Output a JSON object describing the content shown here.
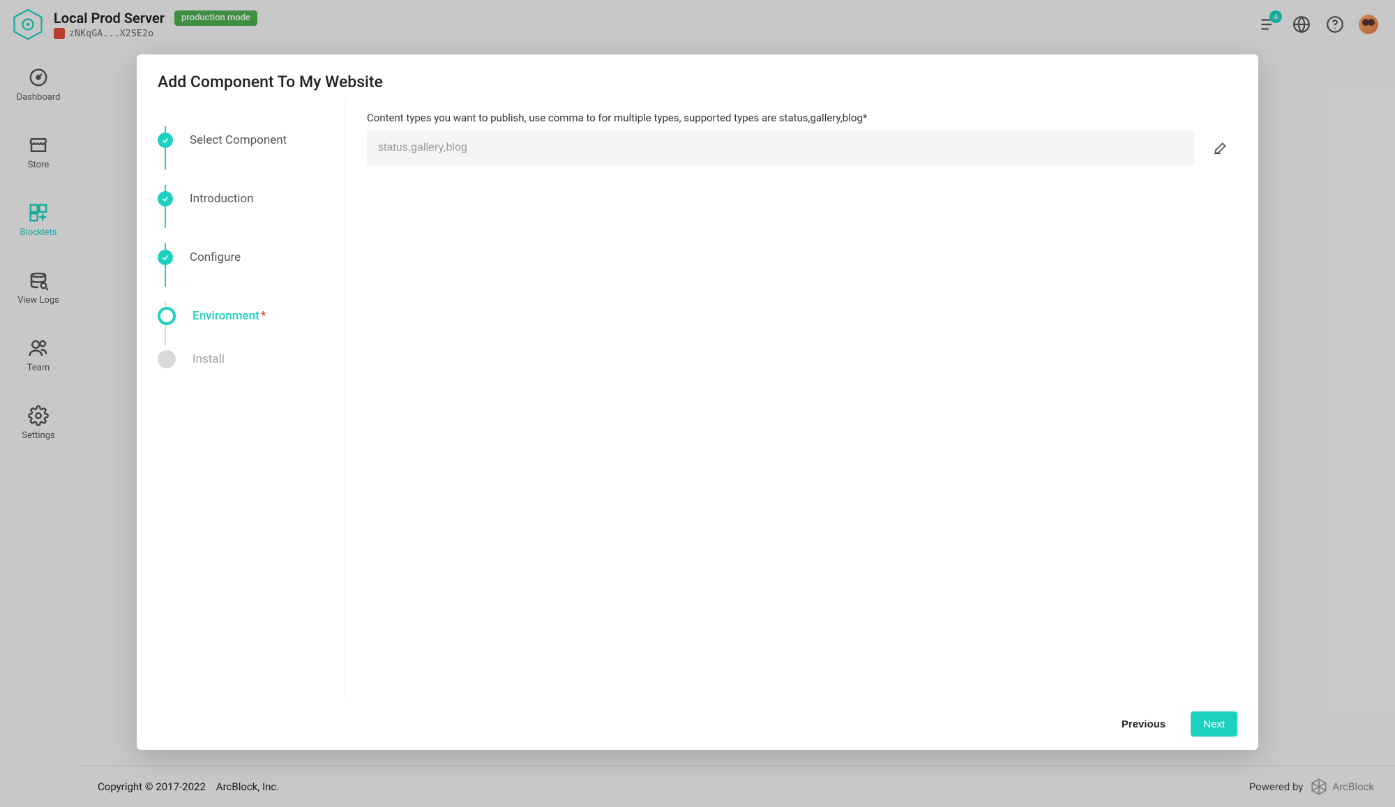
{
  "header": {
    "title": "Local Prod Server",
    "address": "zNKqGA...X2SE2o",
    "mode_badge": "production mode",
    "notification_count": "4"
  },
  "sidebar": {
    "items": [
      {
        "label": "Dashboard"
      },
      {
        "label": "Store"
      },
      {
        "label": "Blocklets"
      },
      {
        "label": "View Logs"
      },
      {
        "label": "Team"
      },
      {
        "label": "Settings"
      }
    ]
  },
  "modal": {
    "title": "Add Component To My Website",
    "steps": [
      {
        "label": "Select Component"
      },
      {
        "label": "Introduction"
      },
      {
        "label": "Configure"
      },
      {
        "label": "Environment"
      },
      {
        "label": "Install"
      }
    ],
    "form": {
      "field_label": "Content types you want to publish, use comma to for multiple types, supported types are status,gallery,blog",
      "placeholder": "status,gallery,blog",
      "value": ""
    },
    "previous": "Previous",
    "next": "Next"
  },
  "footer": {
    "copyright": "Copyright © 2017-2022",
    "company": "ArcBlock, Inc.",
    "powered_by": "Powered by",
    "brand": "ArcBlock"
  }
}
